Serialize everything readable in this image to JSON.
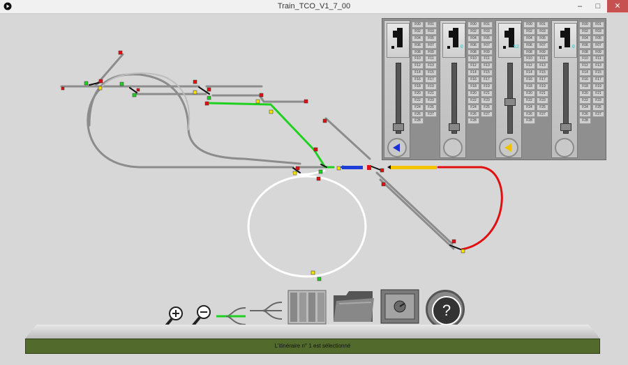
{
  "window": {
    "title": "Train_TCO_V1_7_00",
    "minimize": "–",
    "maximize": "□",
    "close": "✕"
  },
  "controllers": [
    {
      "display": "",
      "arrow_color": "#1a2fd6",
      "slider_level": 0.05
    },
    {
      "display": "0",
      "arrow_color": "",
      "slider_level": 0.05
    },
    {
      "display": "52",
      "arrow_color": "#f2c200",
      "slider_level": 0.45
    },
    {
      "display": "0",
      "arrow_color": "",
      "slider_level": 0.05
    }
  ],
  "function_keys": [
    "F00",
    "F01",
    "F02",
    "F03",
    "F04",
    "F05",
    "F06",
    "F07",
    "F08",
    "F09",
    "F10",
    "F11",
    "F12",
    "F13",
    "F14",
    "F15",
    "F16",
    "F17",
    "F18",
    "F19",
    "F20",
    "F21",
    "F22",
    "F23",
    "F24",
    "F25",
    "F26",
    "F27",
    "F28"
  ],
  "toolbar": {
    "zoom_in_icon": "zoom-in-icon",
    "zoom_out_icon": "zoom-out-icon",
    "route_icon": "route-icon",
    "switch_icon": "switch-icon",
    "controllers_icon": "controllers-icon",
    "folder_icon": "folder-icon",
    "safe_icon": "safe-icon",
    "help_label": "?"
  },
  "status": {
    "message": "L'itinéraire n° 1 est sélectionné"
  },
  "colors": {
    "track_default": "#8c8c8c",
    "track_route": "#1fd11f",
    "track_occupied": "#e01010",
    "track_white": "#ffffff",
    "train_blue": "#1d3fd8",
    "train_yellow": "#f4c400",
    "status_bg": "#526a2c"
  }
}
